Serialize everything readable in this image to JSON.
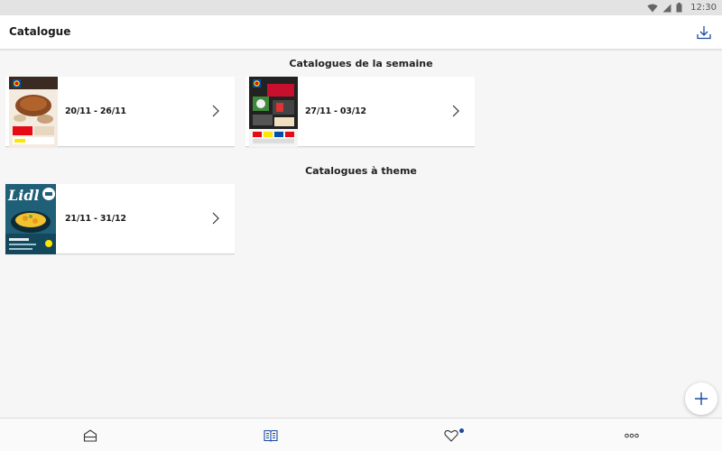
{
  "status_bar": {
    "time": "12:30",
    "icons": [
      "wifi-icon",
      "signal-icon",
      "battery-icon"
    ]
  },
  "app_bar": {
    "title": "Catalogue",
    "action_icon": "download-icon"
  },
  "sections": [
    {
      "title": "Catalogues de la semaine",
      "cards": [
        {
          "date_range": "20/11 - 26/11",
          "thumbnail": "weekly-catalogue-cover"
        },
        {
          "date_range": "27/11 - 03/12",
          "thumbnail": "weekly-catalogue-cover"
        }
      ]
    },
    {
      "title": "Catalogues à theme",
      "cards": [
        {
          "date_range": "21/11 - 31/12",
          "thumbnail": "theme-catalogue-cover",
          "cover_text": "Lidl"
        }
      ]
    }
  ],
  "fab": {
    "icon": "plus-icon"
  },
  "bottom_nav": {
    "items": [
      {
        "icon": "home-icon",
        "active": false
      },
      {
        "icon": "catalogue-icon",
        "active": true
      },
      {
        "icon": "heart-icon",
        "active": false,
        "has_badge": true
      },
      {
        "icon": "more-icon",
        "active": false
      }
    ]
  },
  "colors": {
    "accent": "#1a4aa0",
    "lidl_blue": "#0050aa",
    "lidl_yellow": "#ffe600",
    "lidl_red": "#e60a14"
  }
}
